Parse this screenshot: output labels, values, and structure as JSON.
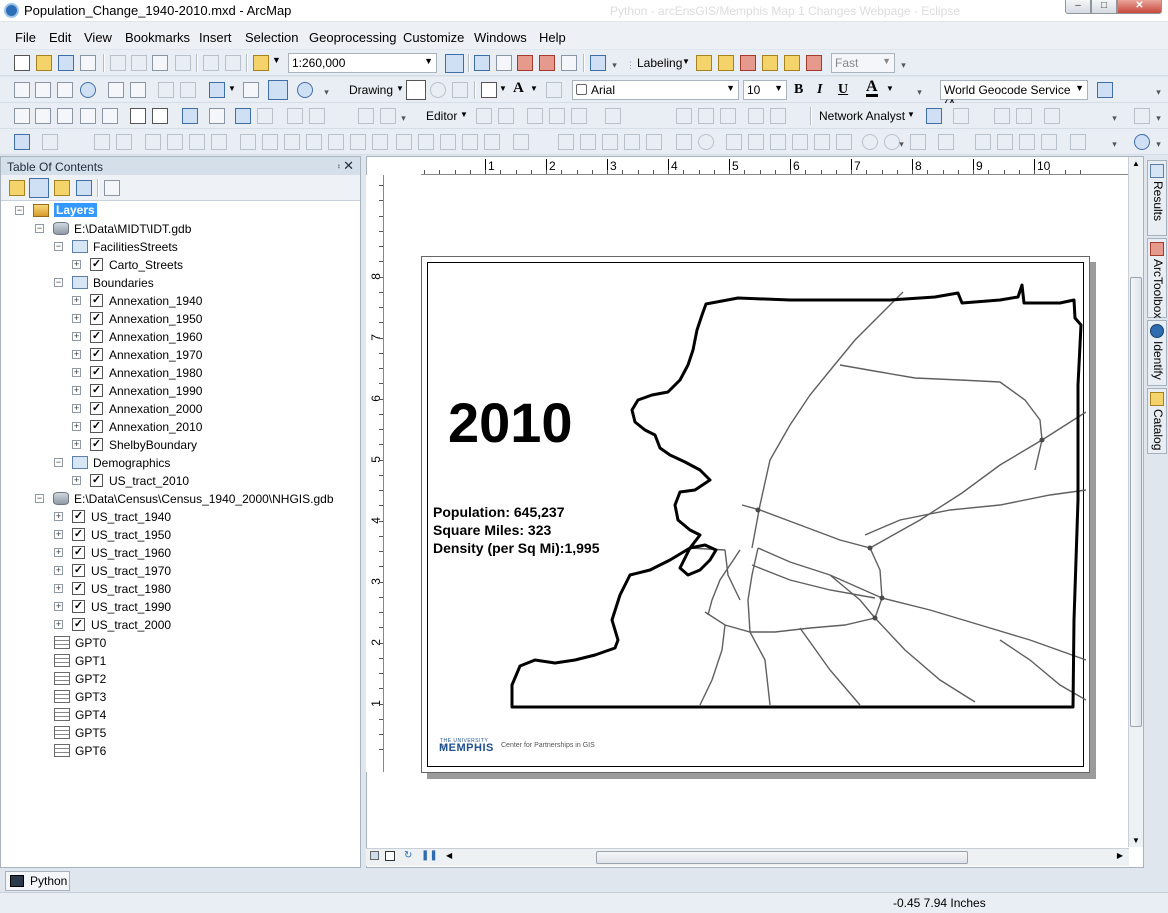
{
  "window": {
    "title": "Population_Change_1940-2010.mxd - ArcMap",
    "ghost_title": "Python - arcEnsGIS/Memphis Map 1 Changes Webpage - Eclipse",
    "min_glyph": "–",
    "max_glyph": "□",
    "close_glyph": "✕"
  },
  "menu": [
    "File",
    "Edit",
    "View",
    "Bookmarks",
    "Insert",
    "Selection",
    "Geoprocessing",
    "Customize",
    "Windows",
    "Help"
  ],
  "toolbar1": {
    "scale": "1:260,000",
    "labeling": "Labeling",
    "quality": "Fast"
  },
  "toolbar2": {
    "drawing": "Drawing",
    "font": "Arial",
    "font_size": "10",
    "bold": "B",
    "italic": "I",
    "underline": "U",
    "font_color_letter": "A",
    "text_letter": "A",
    "geocoder": "World Geocode Service (A"
  },
  "toolbar3": {
    "editor": "Editor",
    "network_analyst": "Network Analyst"
  },
  "toc": {
    "title": "Table Of Contents",
    "pin": "⨾",
    "close": "✕",
    "tree": [
      {
        "label": "Layers",
        "type": "dataframe",
        "level": 0,
        "expanded": true,
        "selected": true
      },
      {
        "label": "E:\\Data\\MIDT\\IDT.gdb",
        "type": "database",
        "level": 1,
        "expanded": true
      },
      {
        "label": "FacilitiesStreets",
        "type": "dataset",
        "level": 2,
        "expanded": true
      },
      {
        "label": "Carto_Streets",
        "type": "layer",
        "level": 3,
        "checked": true
      },
      {
        "label": "Boundaries",
        "type": "dataset",
        "level": 2,
        "expanded": true
      },
      {
        "label": "Annexation_1940",
        "type": "layer",
        "level": 3,
        "checked": true
      },
      {
        "label": "Annexation_1950",
        "type": "layer",
        "level": 3,
        "checked": true
      },
      {
        "label": "Annexation_1960",
        "type": "layer",
        "level": 3,
        "checked": true
      },
      {
        "label": "Annexation_1970",
        "type": "layer",
        "level": 3,
        "checked": true
      },
      {
        "label": "Annexation_1980",
        "type": "layer",
        "level": 3,
        "checked": true
      },
      {
        "label": "Annexation_1990",
        "type": "layer",
        "level": 3,
        "checked": true
      },
      {
        "label": "Annexation_2000",
        "type": "layer",
        "level": 3,
        "checked": true
      },
      {
        "label": "Annexation_2010",
        "type": "layer",
        "level": 3,
        "checked": true
      },
      {
        "label": "ShelbyBoundary",
        "type": "layer",
        "level": 3,
        "checked": true
      },
      {
        "label": "Demographics",
        "type": "dataset",
        "level": 2,
        "expanded": true
      },
      {
        "label": "US_tract_2010",
        "type": "layer",
        "level": 3,
        "checked": true
      },
      {
        "label": "E:\\Data\\Census\\Census_1940_2000\\NHGIS.gdb",
        "type": "database",
        "level": 1,
        "expanded": true
      },
      {
        "label": "US_tract_1940",
        "type": "layer",
        "level": 2,
        "checked": true
      },
      {
        "label": "US_tract_1950",
        "type": "layer",
        "level": 2,
        "checked": true
      },
      {
        "label": "US_tract_1960",
        "type": "layer",
        "level": 2,
        "checked": true
      },
      {
        "label": "US_tract_1970",
        "type": "layer",
        "level": 2,
        "checked": true
      },
      {
        "label": "US_tract_1980",
        "type": "layer",
        "level": 2,
        "checked": true
      },
      {
        "label": "US_tract_1990",
        "type": "layer",
        "level": 2,
        "checked": true
      },
      {
        "label": "US_tract_2000",
        "type": "layer",
        "level": 2,
        "checked": true
      },
      {
        "label": "GPT0",
        "type": "table",
        "level": 2
      },
      {
        "label": "GPT1",
        "type": "table",
        "level": 2
      },
      {
        "label": "GPT2",
        "type": "table",
        "level": 2
      },
      {
        "label": "GPT3",
        "type": "table",
        "level": 2
      },
      {
        "label": "GPT4",
        "type": "table",
        "level": 2
      },
      {
        "label": "GPT5",
        "type": "table",
        "level": 2
      },
      {
        "label": "GPT6",
        "type": "table",
        "level": 2
      }
    ]
  },
  "layout": {
    "year": "2010",
    "population": "Population: 645,237",
    "square_miles": "Square Miles: 323",
    "density": "Density (per Sq Mi):1,995",
    "logo_small": "THE UNIVERSITY OF",
    "logo_big": "MEMPHIS",
    "center_text": "Center for Partnerships in GIS",
    "hruler_labels": [
      "1",
      "2",
      "3",
      "4",
      "5",
      "6",
      "7",
      "8",
      "9",
      "10"
    ],
    "vruler_labels": [
      "8",
      "7",
      "6",
      "5",
      "4",
      "3",
      "2",
      "1"
    ]
  },
  "side_tabs": [
    "Results",
    "ArcToolbox",
    "Identify",
    "Catalog"
  ],
  "python_tab": "Python",
  "status": {
    "coordinates": "-0.45  7.94 Inches"
  }
}
